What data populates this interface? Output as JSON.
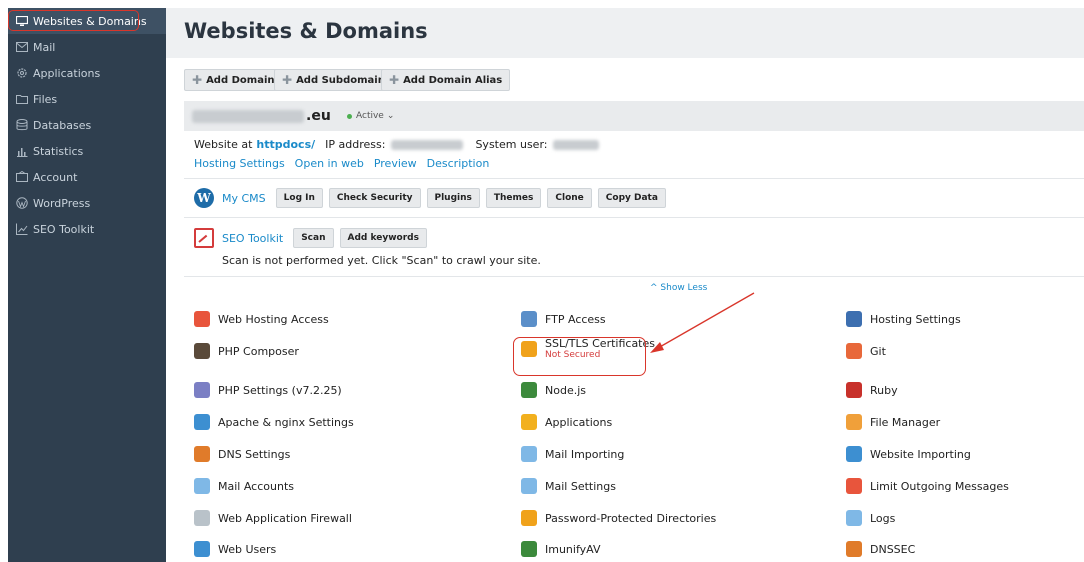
{
  "sidebar": {
    "items": [
      {
        "label": "Websites & Domains",
        "icon": "monitor-icon"
      },
      {
        "label": "Mail",
        "icon": "mail-icon"
      },
      {
        "label": "Applications",
        "icon": "gear-icon"
      },
      {
        "label": "Files",
        "icon": "folder-icon"
      },
      {
        "label": "Databases",
        "icon": "database-icon"
      },
      {
        "label": "Statistics",
        "icon": "bar-chart-icon"
      },
      {
        "label": "Account",
        "icon": "account-icon"
      },
      {
        "label": "WordPress",
        "icon": "wordpress-icon"
      },
      {
        "label": "SEO Toolkit",
        "icon": "seo-icon"
      }
    ],
    "collapse_glyph": "‹"
  },
  "page": {
    "title": "Websites & Domains"
  },
  "toolbar": {
    "add_domain": "Add Domain",
    "add_subdomain": "Add Subdomain",
    "add_domain_alias": "Add Domain Alias",
    "plus_glyph": "✚"
  },
  "domain": {
    "suffix": ".eu",
    "status": "Active",
    "status_glyph": "⌄",
    "website_at_label": "Website at",
    "docroot": "httpdocs/",
    "ip_label": "IP address:",
    "system_user_label": "System user:",
    "links": [
      "Hosting Settings",
      "Open in web",
      "Preview",
      "Description"
    ]
  },
  "wordpress": {
    "logo_glyph": "W",
    "label": "My CMS",
    "buttons": [
      "Log In",
      "Check Security",
      "Plugins",
      "Themes",
      "Clone",
      "Copy Data"
    ]
  },
  "seo": {
    "label": "SEO Toolkit",
    "buttons": [
      "Scan",
      "Add keywords"
    ],
    "note": "Scan is not performed yet. Click \"Scan\" to crawl your site."
  },
  "show_less": "^ Show Less",
  "tools": {
    "col1": [
      {
        "label": "Web Hosting Access",
        "color": "#e8553c"
      },
      {
        "label": "PHP Composer",
        "color": "#5a4a3a"
      },
      {
        "label": "PHP Settings (v7.2.25)",
        "color": "#7b7fc4"
      },
      {
        "label": "Apache & nginx Settings",
        "color": "#3d8fd1"
      },
      {
        "label": "DNS Settings",
        "color": "#e07b2a"
      },
      {
        "label": "Mail Accounts",
        "color": "#7fb8e6"
      },
      {
        "label": "Web Application Firewall",
        "color": "#b9c2c9"
      },
      {
        "label": "Web Users",
        "color": "#3d8fd1"
      }
    ],
    "col2": [
      {
        "label": "FTP Access",
        "color": "#5b8fc9"
      },
      {
        "label": "SSL/TLS Certificates",
        "sub": "Not Secured",
        "color": "#f0a21b"
      },
      {
        "label": "Node.js",
        "color": "#3c8a3c"
      },
      {
        "label": "Applications",
        "color": "#f2b01e"
      },
      {
        "label": "Mail Importing",
        "color": "#7fb8e6"
      },
      {
        "label": "Mail Settings",
        "color": "#7fb8e6"
      },
      {
        "label": "Password-Protected Directories",
        "color": "#f0a21b"
      },
      {
        "label": "ImunifyAV",
        "color": "#3c8a3c"
      }
    ],
    "col3": [
      {
        "label": "Hosting Settings",
        "color": "#3d6fb0"
      },
      {
        "label": "Git",
        "color": "#e8683a"
      },
      {
        "label": "Ruby",
        "color": "#c8312b"
      },
      {
        "label": "File Manager",
        "color": "#f0a03a"
      },
      {
        "label": "Website Importing",
        "color": "#3d8fd1"
      },
      {
        "label": "Limit Outgoing Messages",
        "color": "#e8553c"
      },
      {
        "label": "Logs",
        "color": "#7fb8e6"
      },
      {
        "label": "DNSSEC",
        "color": "#e07b2a"
      }
    ]
  },
  "colors": {
    "sidebar_bg": "#2f3f4f",
    "link": "#1a8ac9",
    "annotation": "#d9362b"
  }
}
